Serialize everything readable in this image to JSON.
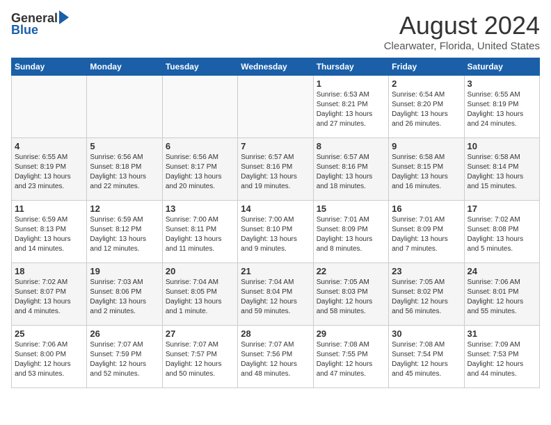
{
  "header": {
    "logo_general": "General",
    "logo_blue": "Blue",
    "month": "August 2024",
    "location": "Clearwater, Florida, United States"
  },
  "weekdays": [
    "Sunday",
    "Monday",
    "Tuesday",
    "Wednesday",
    "Thursday",
    "Friday",
    "Saturday"
  ],
  "weeks": [
    [
      {
        "day": "",
        "info": ""
      },
      {
        "day": "",
        "info": ""
      },
      {
        "day": "",
        "info": ""
      },
      {
        "day": "",
        "info": ""
      },
      {
        "day": "1",
        "info": "Sunrise: 6:53 AM\nSunset: 8:21 PM\nDaylight: 13 hours\nand 27 minutes."
      },
      {
        "day": "2",
        "info": "Sunrise: 6:54 AM\nSunset: 8:20 PM\nDaylight: 13 hours\nand 26 minutes."
      },
      {
        "day": "3",
        "info": "Sunrise: 6:55 AM\nSunset: 8:19 PM\nDaylight: 13 hours\nand 24 minutes."
      }
    ],
    [
      {
        "day": "4",
        "info": "Sunrise: 6:55 AM\nSunset: 8:19 PM\nDaylight: 13 hours\nand 23 minutes."
      },
      {
        "day": "5",
        "info": "Sunrise: 6:56 AM\nSunset: 8:18 PM\nDaylight: 13 hours\nand 22 minutes."
      },
      {
        "day": "6",
        "info": "Sunrise: 6:56 AM\nSunset: 8:17 PM\nDaylight: 13 hours\nand 20 minutes."
      },
      {
        "day": "7",
        "info": "Sunrise: 6:57 AM\nSunset: 8:16 PM\nDaylight: 13 hours\nand 19 minutes."
      },
      {
        "day": "8",
        "info": "Sunrise: 6:57 AM\nSunset: 8:16 PM\nDaylight: 13 hours\nand 18 minutes."
      },
      {
        "day": "9",
        "info": "Sunrise: 6:58 AM\nSunset: 8:15 PM\nDaylight: 13 hours\nand 16 minutes."
      },
      {
        "day": "10",
        "info": "Sunrise: 6:58 AM\nSunset: 8:14 PM\nDaylight: 13 hours\nand 15 minutes."
      }
    ],
    [
      {
        "day": "11",
        "info": "Sunrise: 6:59 AM\nSunset: 8:13 PM\nDaylight: 13 hours\nand 14 minutes."
      },
      {
        "day": "12",
        "info": "Sunrise: 6:59 AM\nSunset: 8:12 PM\nDaylight: 13 hours\nand 12 minutes."
      },
      {
        "day": "13",
        "info": "Sunrise: 7:00 AM\nSunset: 8:11 PM\nDaylight: 13 hours\nand 11 minutes."
      },
      {
        "day": "14",
        "info": "Sunrise: 7:00 AM\nSunset: 8:10 PM\nDaylight: 13 hours\nand 9 minutes."
      },
      {
        "day": "15",
        "info": "Sunrise: 7:01 AM\nSunset: 8:09 PM\nDaylight: 13 hours\nand 8 minutes."
      },
      {
        "day": "16",
        "info": "Sunrise: 7:01 AM\nSunset: 8:09 PM\nDaylight: 13 hours\nand 7 minutes."
      },
      {
        "day": "17",
        "info": "Sunrise: 7:02 AM\nSunset: 8:08 PM\nDaylight: 13 hours\nand 5 minutes."
      }
    ],
    [
      {
        "day": "18",
        "info": "Sunrise: 7:02 AM\nSunset: 8:07 PM\nDaylight: 13 hours\nand 4 minutes."
      },
      {
        "day": "19",
        "info": "Sunrise: 7:03 AM\nSunset: 8:06 PM\nDaylight: 13 hours\nand 2 minutes."
      },
      {
        "day": "20",
        "info": "Sunrise: 7:04 AM\nSunset: 8:05 PM\nDaylight: 13 hours\nand 1 minute."
      },
      {
        "day": "21",
        "info": "Sunrise: 7:04 AM\nSunset: 8:04 PM\nDaylight: 12 hours\nand 59 minutes."
      },
      {
        "day": "22",
        "info": "Sunrise: 7:05 AM\nSunset: 8:03 PM\nDaylight: 12 hours\nand 58 minutes."
      },
      {
        "day": "23",
        "info": "Sunrise: 7:05 AM\nSunset: 8:02 PM\nDaylight: 12 hours\nand 56 minutes."
      },
      {
        "day": "24",
        "info": "Sunrise: 7:06 AM\nSunset: 8:01 PM\nDaylight: 12 hours\nand 55 minutes."
      }
    ],
    [
      {
        "day": "25",
        "info": "Sunrise: 7:06 AM\nSunset: 8:00 PM\nDaylight: 12 hours\nand 53 minutes."
      },
      {
        "day": "26",
        "info": "Sunrise: 7:07 AM\nSunset: 7:59 PM\nDaylight: 12 hours\nand 52 minutes."
      },
      {
        "day": "27",
        "info": "Sunrise: 7:07 AM\nSunset: 7:57 PM\nDaylight: 12 hours\nand 50 minutes."
      },
      {
        "day": "28",
        "info": "Sunrise: 7:07 AM\nSunset: 7:56 PM\nDaylight: 12 hours\nand 48 minutes."
      },
      {
        "day": "29",
        "info": "Sunrise: 7:08 AM\nSunset: 7:55 PM\nDaylight: 12 hours\nand 47 minutes."
      },
      {
        "day": "30",
        "info": "Sunrise: 7:08 AM\nSunset: 7:54 PM\nDaylight: 12 hours\nand 45 minutes."
      },
      {
        "day": "31",
        "info": "Sunrise: 7:09 AM\nSunset: 7:53 PM\nDaylight: 12 hours\nand 44 minutes."
      }
    ]
  ]
}
